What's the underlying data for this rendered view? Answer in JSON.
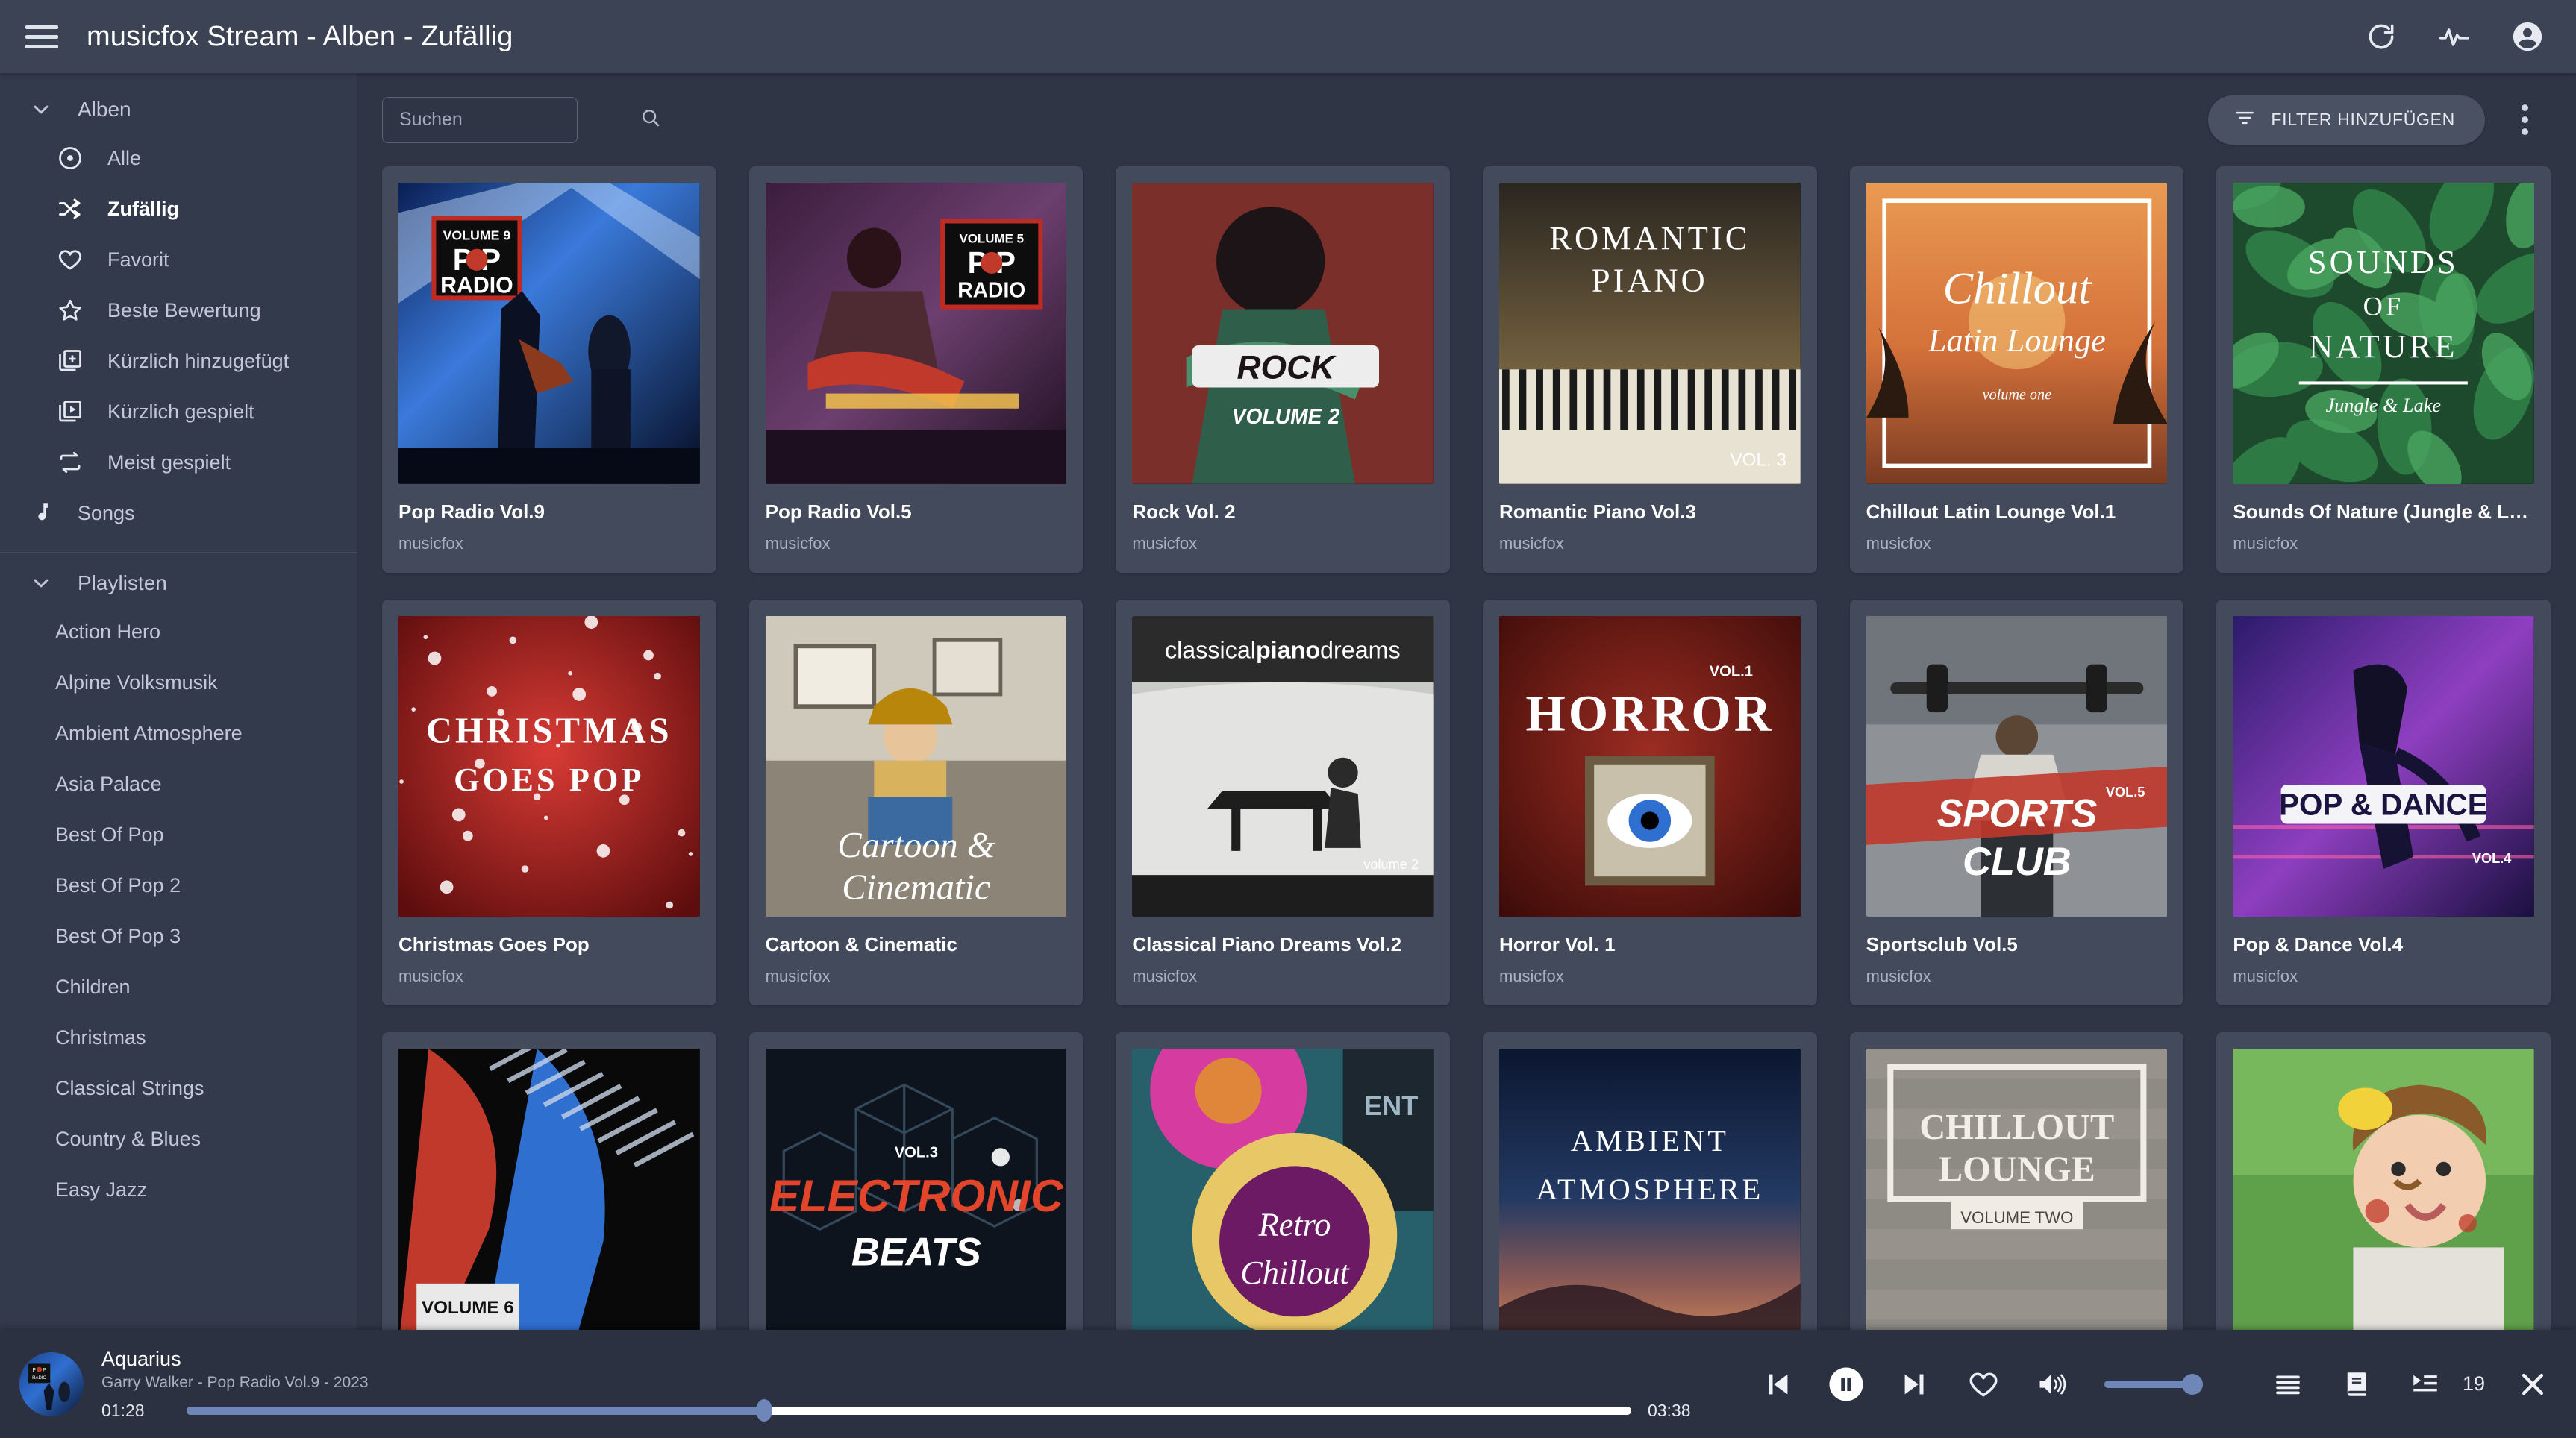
{
  "topbar": {
    "menu_icon": "hamburger-icon",
    "title": "musicfox Stream - Alben - Zufällig",
    "icons": [
      "refresh-icon",
      "activity-pulse-icon",
      "account-circle-icon"
    ]
  },
  "sidebar": {
    "groups": [
      {
        "label": "Alben",
        "expanded": true,
        "items": [
          {
            "label": "Alle",
            "icon": "disc-icon",
            "active": false
          },
          {
            "label": "Zufällig",
            "icon": "shuffle-icon",
            "active": true
          },
          {
            "label": "Favorit",
            "icon": "heart-outline-icon",
            "active": false
          },
          {
            "label": "Beste Bewertung",
            "icon": "star-outline-icon",
            "active": false
          },
          {
            "label": "Kürzlich hinzugefügt",
            "icon": "library-add-icon",
            "active": false
          },
          {
            "label": "Kürzlich gespielt",
            "icon": "library-play-icon",
            "active": false
          },
          {
            "label": "Meist gespielt",
            "icon": "repeat-icon",
            "active": false
          }
        ]
      }
    ],
    "songs_item": {
      "label": "Songs",
      "icon": "music-note-icon"
    },
    "playlists_group": {
      "label": "Playlisten",
      "expanded": true
    },
    "playlists": [
      {
        "label": "Action Hero"
      },
      {
        "label": "Alpine Volksmusik"
      },
      {
        "label": "Ambient Atmosphere"
      },
      {
        "label": "Asia Palace"
      },
      {
        "label": "Best Of Pop"
      },
      {
        "label": "Best Of Pop 2"
      },
      {
        "label": "Best Of Pop 3"
      },
      {
        "label": "Children"
      },
      {
        "label": "Christmas"
      },
      {
        "label": "Classical Strings"
      },
      {
        "label": "Country & Blues"
      },
      {
        "label": "Easy Jazz"
      }
    ]
  },
  "toolbar": {
    "search_placeholder": "Suchen",
    "search_value": "",
    "search_icon": "search-icon",
    "filter_label": "FILTER HINZUFÜGEN",
    "filter_icon": "filter-icon",
    "overflow_icon": "more-vertical-icon"
  },
  "albums": [
    {
      "title": "Pop Radio Vol.9",
      "artist": "musicfox",
      "cover": "pop-radio-9"
    },
    {
      "title": "Pop Radio Vol.5",
      "artist": "musicfox",
      "cover": "pop-radio-5"
    },
    {
      "title": "Rock Vol. 2",
      "artist": "musicfox",
      "cover": "rock-2"
    },
    {
      "title": "Romantic Piano Vol.3",
      "artist": "musicfox",
      "cover": "romantic-piano"
    },
    {
      "title": "Chillout Latin Lounge Vol.1",
      "artist": "musicfox",
      "cover": "chillout-latin"
    },
    {
      "title": "Sounds Of Nature (Jungle & L…",
      "artist": "musicfox",
      "cover": "sounds-nature"
    },
    {
      "title": "Christmas Goes Pop",
      "artist": "musicfox",
      "cover": "christmas-pop"
    },
    {
      "title": "Cartoon & Cinematic",
      "artist": "musicfox",
      "cover": "cartoon-cinematic"
    },
    {
      "title": "Classical Piano Dreams Vol.2",
      "artist": "musicfox",
      "cover": "classical-piano"
    },
    {
      "title": "Horror Vol. 1",
      "artist": "musicfox",
      "cover": "horror-1"
    },
    {
      "title": "Sportsclub Vol.5",
      "artist": "musicfox",
      "cover": "sportsclub-5"
    },
    {
      "title": "Pop & Dance Vol.4",
      "artist": "musicfox",
      "cover": "pop-dance-4"
    },
    {
      "title": "",
      "artist": "",
      "cover": "pop-volume-6"
    },
    {
      "title": "",
      "artist": "",
      "cover": "electronic-beats"
    },
    {
      "title": "",
      "artist": "",
      "cover": "retro-chillout"
    },
    {
      "title": "",
      "artist": "",
      "cover": "ambient-atmosphere"
    },
    {
      "title": "",
      "artist": "",
      "cover": "chillout-lounge"
    },
    {
      "title": "",
      "artist": "",
      "cover": "children-girl"
    }
  ],
  "player": {
    "track_title": "Aquarius",
    "track_subtitle": "Garry Walker - Pop Radio Vol.9 - 2023",
    "elapsed": "01:28",
    "duration": "03:38",
    "progress_percent": 40,
    "volume_percent": 100,
    "queue_count": "19",
    "controls": [
      "previous-icon",
      "pause-icon",
      "next-icon",
      "heart-icon",
      "volume-icon",
      "volume-slider",
      "equalizer-icon",
      "lyrics-icon",
      "queue-icon",
      "close-icon"
    ]
  },
  "colors": {
    "page_bg": "#2f3545",
    "sidebar_bg": "#333a4b",
    "topbar_bg": "#3c4354",
    "card_bg": "#434a5c",
    "player_bg": "#2b3140",
    "accent": "#6e87b8",
    "text_primary": "#ffffff",
    "text_muted": "#aab1c1"
  }
}
